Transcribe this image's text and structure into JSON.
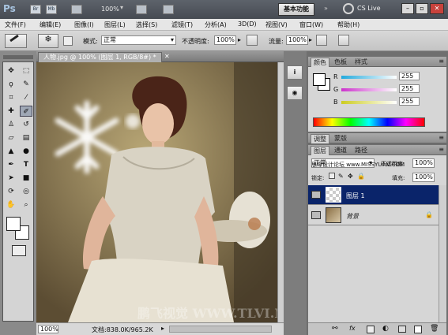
{
  "app": {
    "logo": "Ps",
    "zoom": "100%",
    "workspace": "基本功能",
    "cslive": "CS Live"
  },
  "menu": [
    "文件(F)",
    "编辑(E)",
    "图像(I)",
    "图层(L)",
    "选择(S)",
    "滤镜(T)",
    "分析(A)",
    "3D(D)",
    "视图(V)",
    "窗口(W)",
    "帮助(H)"
  ],
  "options": {
    "mode_label": "模式:",
    "mode_value": "正常",
    "opacity_label": "不透明度:",
    "opacity_value": "100%",
    "flow_label": "流量:",
    "flow_value": "100%"
  },
  "document": {
    "tab": "人物.jpg @ 100% (图层 1, RGB/8#) *",
    "zoom": "100%",
    "doc_info": "文档:838.0K/965.2K",
    "watermark": "鹏飞视觉 WWW.TLVI.NET"
  },
  "color_panel": {
    "tabs": [
      "颜色",
      "色板",
      "样式"
    ],
    "sliders": [
      {
        "label": "R",
        "value": "255",
        "color": "#26c6cc"
      },
      {
        "label": "G",
        "value": "255",
        "color": "#c83ac8"
      },
      {
        "label": "B",
        "value": "255",
        "color": "#cccc2a"
      }
    ]
  },
  "adjust_panel": {
    "tabs": [
      "调整",
      "蒙版"
    ]
  },
  "layers_panel": {
    "tabs": [
      "图层",
      "通道",
      "路径"
    ],
    "blend_mode": "正常",
    "site_watermark": "思缘设计论坛 www.MISSYUAN.COM",
    "opacity_label": "不透明度:",
    "opacity_value": "100%",
    "lock_label": "锁定:",
    "fill_label": "填充:",
    "fill_value": "100%",
    "layers": [
      {
        "name": "图层 1",
        "selected": true
      },
      {
        "name": "背景",
        "selected": false
      }
    ]
  },
  "colors": {
    "accent_selection": "#0a246a",
    "foreground": "#ffffff",
    "background": "#ffffff"
  }
}
